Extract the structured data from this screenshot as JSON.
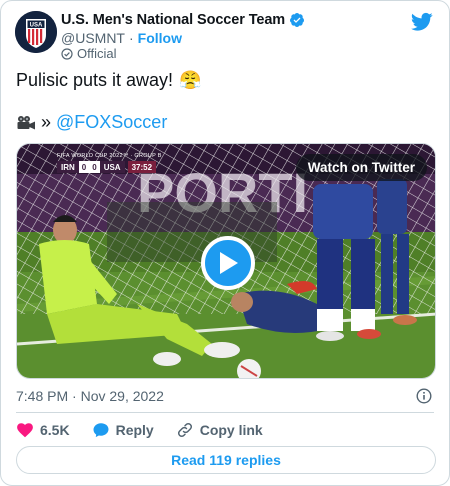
{
  "author": {
    "display_name": "U.S. Men's National Soccer Team",
    "handle": "@USMNT",
    "separator": "·",
    "follow_label": "Follow",
    "official_label": "Official",
    "avatar_text": "USA",
    "avatar_icon": "usmnt-crest-icon",
    "verified_icon": "verified-badge-icon"
  },
  "tweet": {
    "line1_text": "Pulisic puts it away!",
    "line1_emoji": "😤",
    "line2_prefix": "»",
    "line2_icon": "movie-camera-icon",
    "mention": "@FOXSoccer"
  },
  "media": {
    "watch_label": "Watch on Twitter",
    "scoreboard": {
      "caption": "FIFA WORLD CUP 2022™ · GROUP B",
      "team1": "IRN",
      "score1": "0",
      "score2": "0",
      "team2": "USA",
      "clock": "37:52"
    },
    "play_icon": "play-icon"
  },
  "meta": {
    "timestamp": "7:48 PM · Nov 29, 2022"
  },
  "actions": {
    "like_count": "6.5K",
    "reply_label": "Reply",
    "copy_label": "Copy link",
    "read_replies_label": "Read 119 replies"
  },
  "colors": {
    "accent": "#1d9bf0",
    "like": "#f91880",
    "text": "#0f1419",
    "secondary": "#536471",
    "border": "#cfd9de"
  }
}
